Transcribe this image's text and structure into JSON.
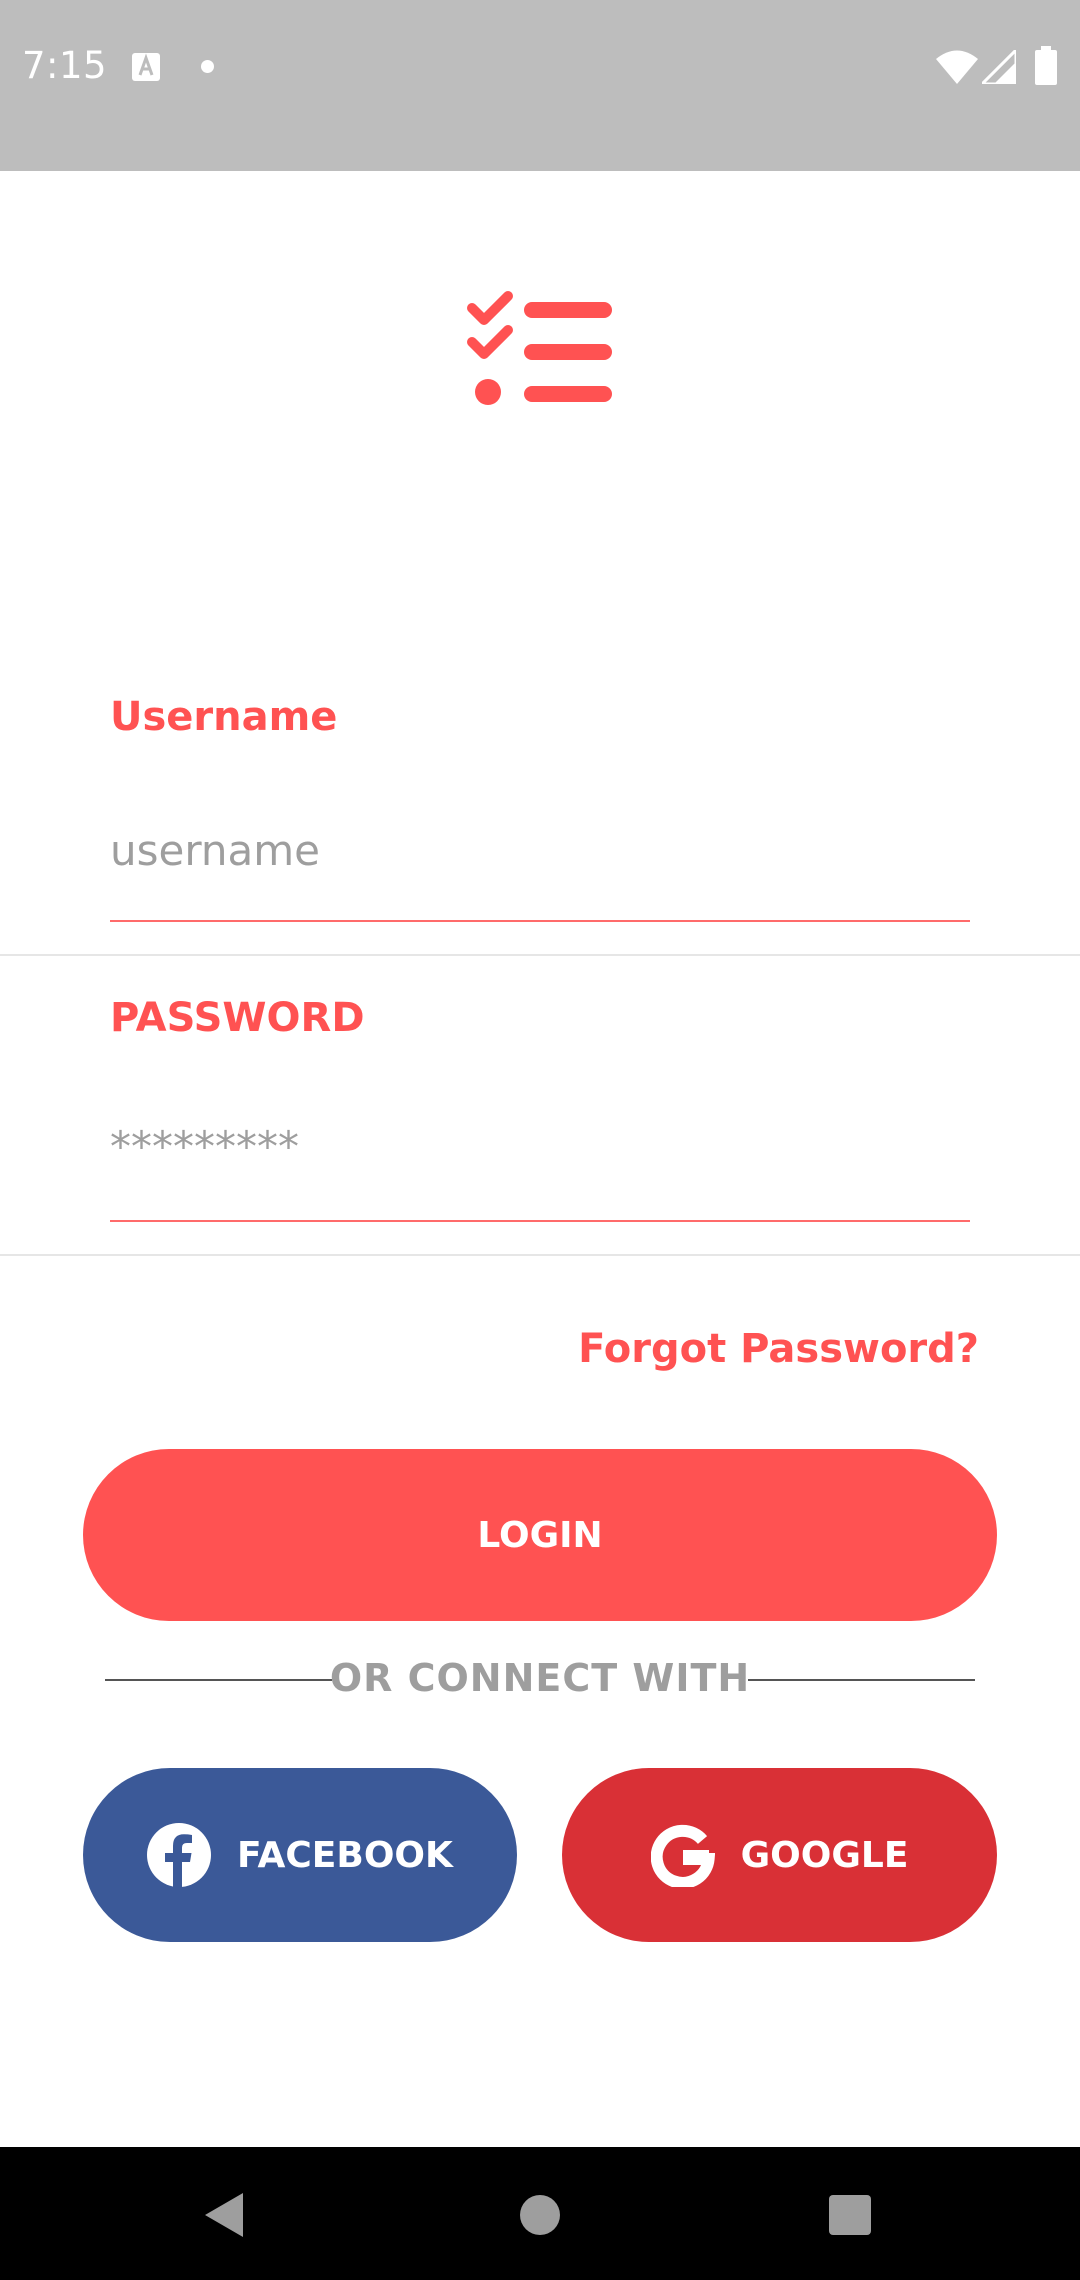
{
  "status_bar": {
    "time": "7:15",
    "icons": [
      "text-a-icon",
      "notification-dot-icon",
      "wifi-icon",
      "signal-icon",
      "battery-icon"
    ]
  },
  "logo": {
    "icon": "checklist-icon",
    "color": "#ff5252"
  },
  "form": {
    "username": {
      "label": "Username",
      "placeholder": "username"
    },
    "password": {
      "label": "PASSWORD",
      "placeholder": "*********"
    },
    "forgot_password": "Forgot Password?",
    "login_label": "LOGIN"
  },
  "social": {
    "divider_text": "OR CONNECT WITH",
    "facebook_label": "FACEBOOK",
    "google_label": "GOOGLE"
  },
  "colors": {
    "accent": "#ff5252",
    "facebook": "#3b5998",
    "google": "#d93036",
    "status_bar": "#bdbdbd"
  },
  "nav_bar": {
    "icons": [
      "back-icon",
      "home-icon",
      "recents-icon"
    ]
  }
}
